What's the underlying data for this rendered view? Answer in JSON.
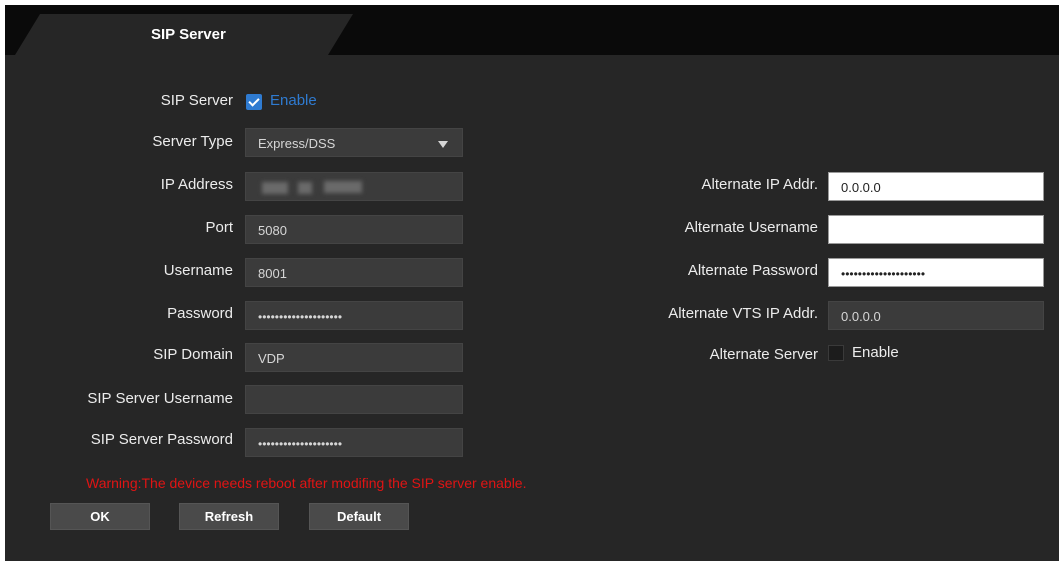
{
  "tab": {
    "title": "SIP Server"
  },
  "left": {
    "sip_server_label": "SIP Server",
    "sip_server_enable": {
      "checked": true,
      "label": "Enable"
    },
    "server_type_label": "Server Type",
    "server_type_value": "Express/DSS",
    "ip_address_label": "IP Address",
    "port_label": "Port",
    "port_value": "5080",
    "username_label": "Username",
    "username_value": "8001",
    "password_label": "Password",
    "password_value": "••••••••••••••••••••",
    "sip_domain_label": "SIP Domain",
    "sip_domain_value": "VDP",
    "sip_server_username_label": "SIP Server Username",
    "sip_server_username_value": "",
    "sip_server_password_label": "SIP Server Password",
    "sip_server_password_value": "••••••••••••••••••••"
  },
  "right": {
    "alt_ip_label": "Alternate IP Addr.",
    "alt_ip_value": "0.0.0.0",
    "alt_username_label": "Alternate Username",
    "alt_username_value": "",
    "alt_password_label": "Alternate Password",
    "alt_password_value": "••••••••••••••••••••",
    "alt_vts_ip_label": "Alternate VTS IP Addr.",
    "alt_vts_ip_value": "0.0.0.0",
    "alt_server_label": "Alternate Server",
    "alt_server_enable": {
      "checked": false,
      "label": "Enable"
    }
  },
  "warning": "Warning:The device needs reboot after modifing the SIP server enable.",
  "buttons": {
    "ok": "OK",
    "refresh": "Refresh",
    "default": "Default"
  },
  "colors": {
    "accent": "#2f7bd1",
    "warning": "#e01414",
    "background": "#262626"
  }
}
